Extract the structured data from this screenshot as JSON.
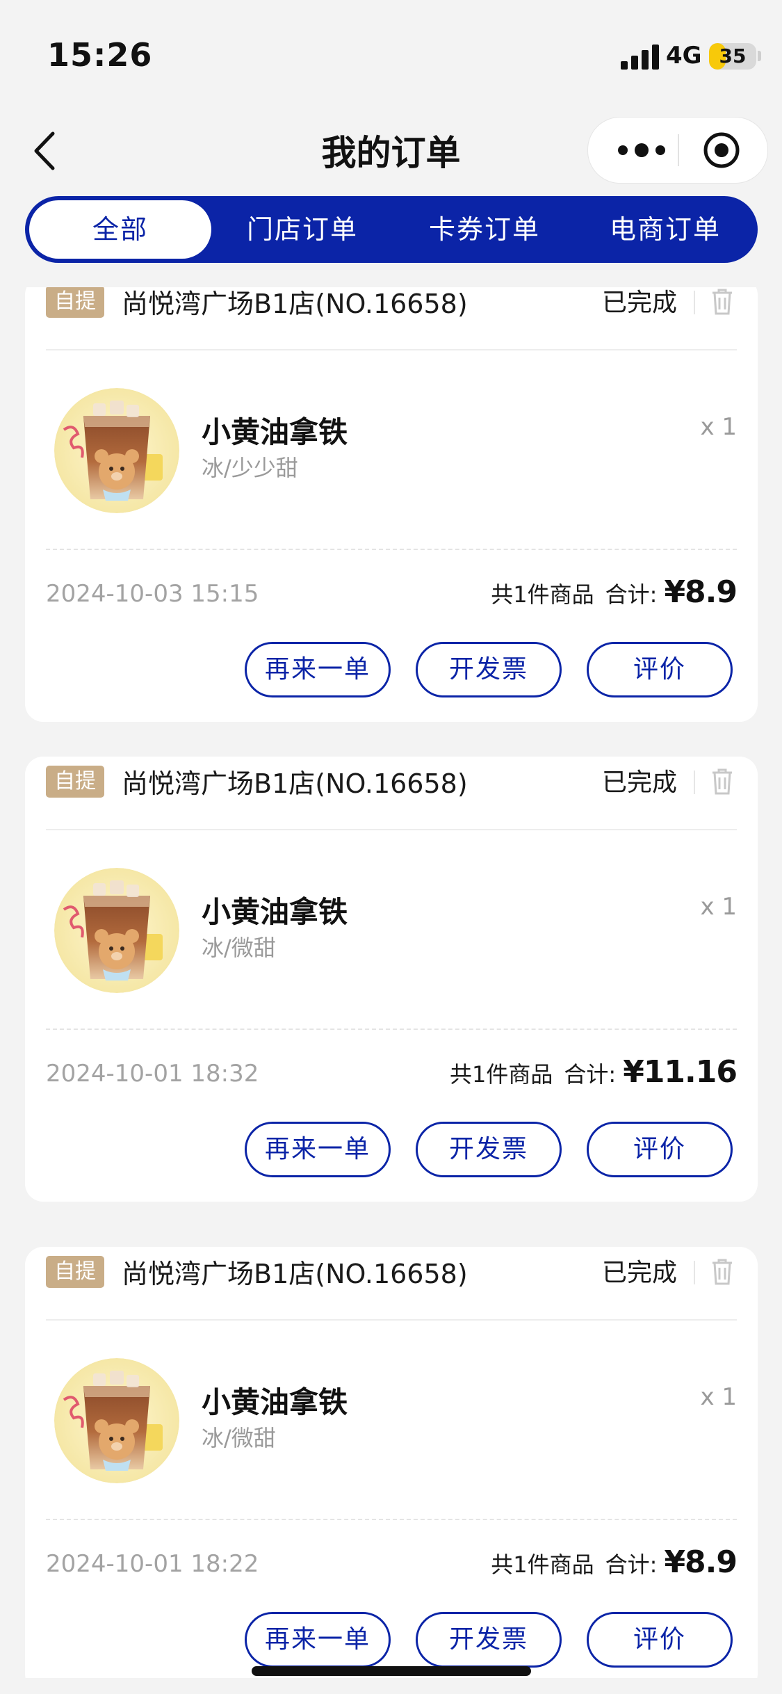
{
  "status_bar": {
    "time": "15:26",
    "network": "4G",
    "battery": "35",
    "battery_level": 0.35
  },
  "nav": {
    "title": "我的订单"
  },
  "tabs": [
    {
      "label": "全部",
      "active": true
    },
    {
      "label": "门店订单",
      "active": false
    },
    {
      "label": "卡券订单",
      "active": false
    },
    {
      "label": "电商订单",
      "active": false
    }
  ],
  "orders": [
    {
      "pickup_label": "自提",
      "store": "尚悦湾广场B1店(NO.16658)",
      "status": "已完成",
      "product": {
        "name": "小黄油拿铁",
        "spec": "冰/少少甜",
        "qty": "x 1"
      },
      "time": "2024-10-03 15:15",
      "count_text": "共1件商品",
      "total_label": "合计:",
      "total": "¥8.9",
      "actions": [
        "再来一单",
        "开发票",
        "评价"
      ]
    },
    {
      "pickup_label": "自提",
      "store": "尚悦湾广场B1店(NO.16658)",
      "status": "已完成",
      "product": {
        "name": "小黄油拿铁",
        "spec": "冰/微甜",
        "qty": "x 1"
      },
      "time": "2024-10-01 18:32",
      "count_text": "共1件商品",
      "total_label": "合计:",
      "total": "¥11.16",
      "actions": [
        "再来一单",
        "开发票",
        "评价"
      ]
    },
    {
      "pickup_label": "自提",
      "store": "尚悦湾广场B1店(NO.16658)",
      "status": "已完成",
      "product": {
        "name": "小黄油拿铁",
        "spec": "冰/微甜",
        "qty": "x 1"
      },
      "time": "2024-10-01 18:22",
      "count_text": "共1件商品",
      "total_label": "合计:",
      "total": "¥8.9",
      "actions": [
        "再来一单",
        "开发票",
        "评价"
      ]
    }
  ],
  "icons": {
    "back": "back-arrow-icon",
    "more": "more-dots-icon",
    "close": "close-target-icon",
    "trash": "trash-icon",
    "signal": "signal-icon",
    "battery": "battery-icon"
  },
  "colors": {
    "brand": "#0b24a7",
    "badge": "#c9ad87",
    "battery": "#f7c90a",
    "background": "#f3f3f3"
  }
}
